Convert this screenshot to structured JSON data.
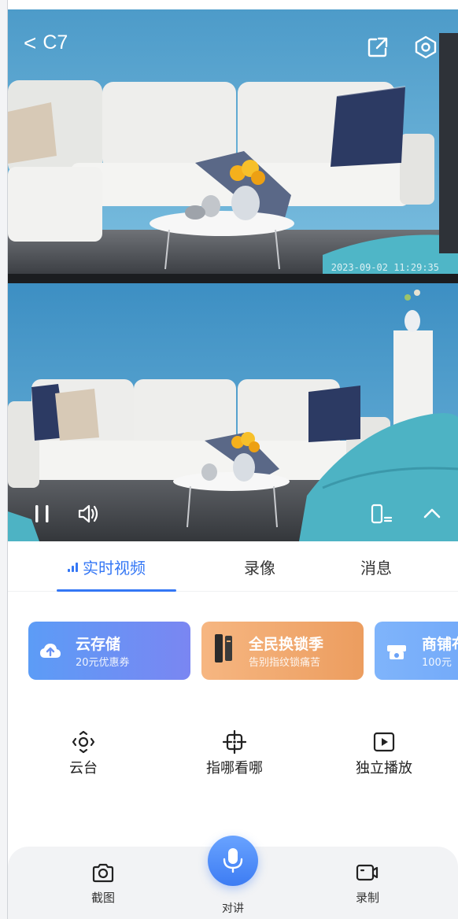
{
  "header": {
    "back_label": "C7",
    "back_icon": "chevron-left-icon",
    "share_icon": "external-link-icon",
    "settings_icon": "settings-hexagon-icon"
  },
  "feed": {
    "timestamp": "2023-09-02 11:29:35"
  },
  "controls": {
    "pause_icon": "pause-icon",
    "volume_icon": "volume-icon",
    "switch_icon": "switch-camera-icon",
    "collapse_icon": "chevron-up-icon"
  },
  "tabs": [
    {
      "label": "实时视频",
      "active": true
    },
    {
      "label": "录像",
      "active": false
    },
    {
      "label": "消息",
      "active": false
    }
  ],
  "promos": [
    {
      "title": "云存储",
      "subtitle": "20元优惠券",
      "icon": "cloud-upload-icon"
    },
    {
      "title": "全民换锁季",
      "subtitle": "告别指纹锁痛苦",
      "icon": "smart-lock-icon"
    },
    {
      "title": "商铺布",
      "subtitle": "100元",
      "icon": "camera-box-icon"
    }
  ],
  "functions": [
    {
      "label": "云台",
      "icon": "ptz-control-icon"
    },
    {
      "label": "指哪看哪",
      "icon": "crosshair-icon"
    },
    {
      "label": "独立播放",
      "icon": "play-square-icon"
    }
  ],
  "bottom": {
    "screenshot_label": "截图",
    "talk_label": "对讲",
    "record_label": "录制"
  },
  "colors": {
    "accent": "#3477f5",
    "wall": "#6aaed3",
    "floor": "#3b3f45"
  }
}
